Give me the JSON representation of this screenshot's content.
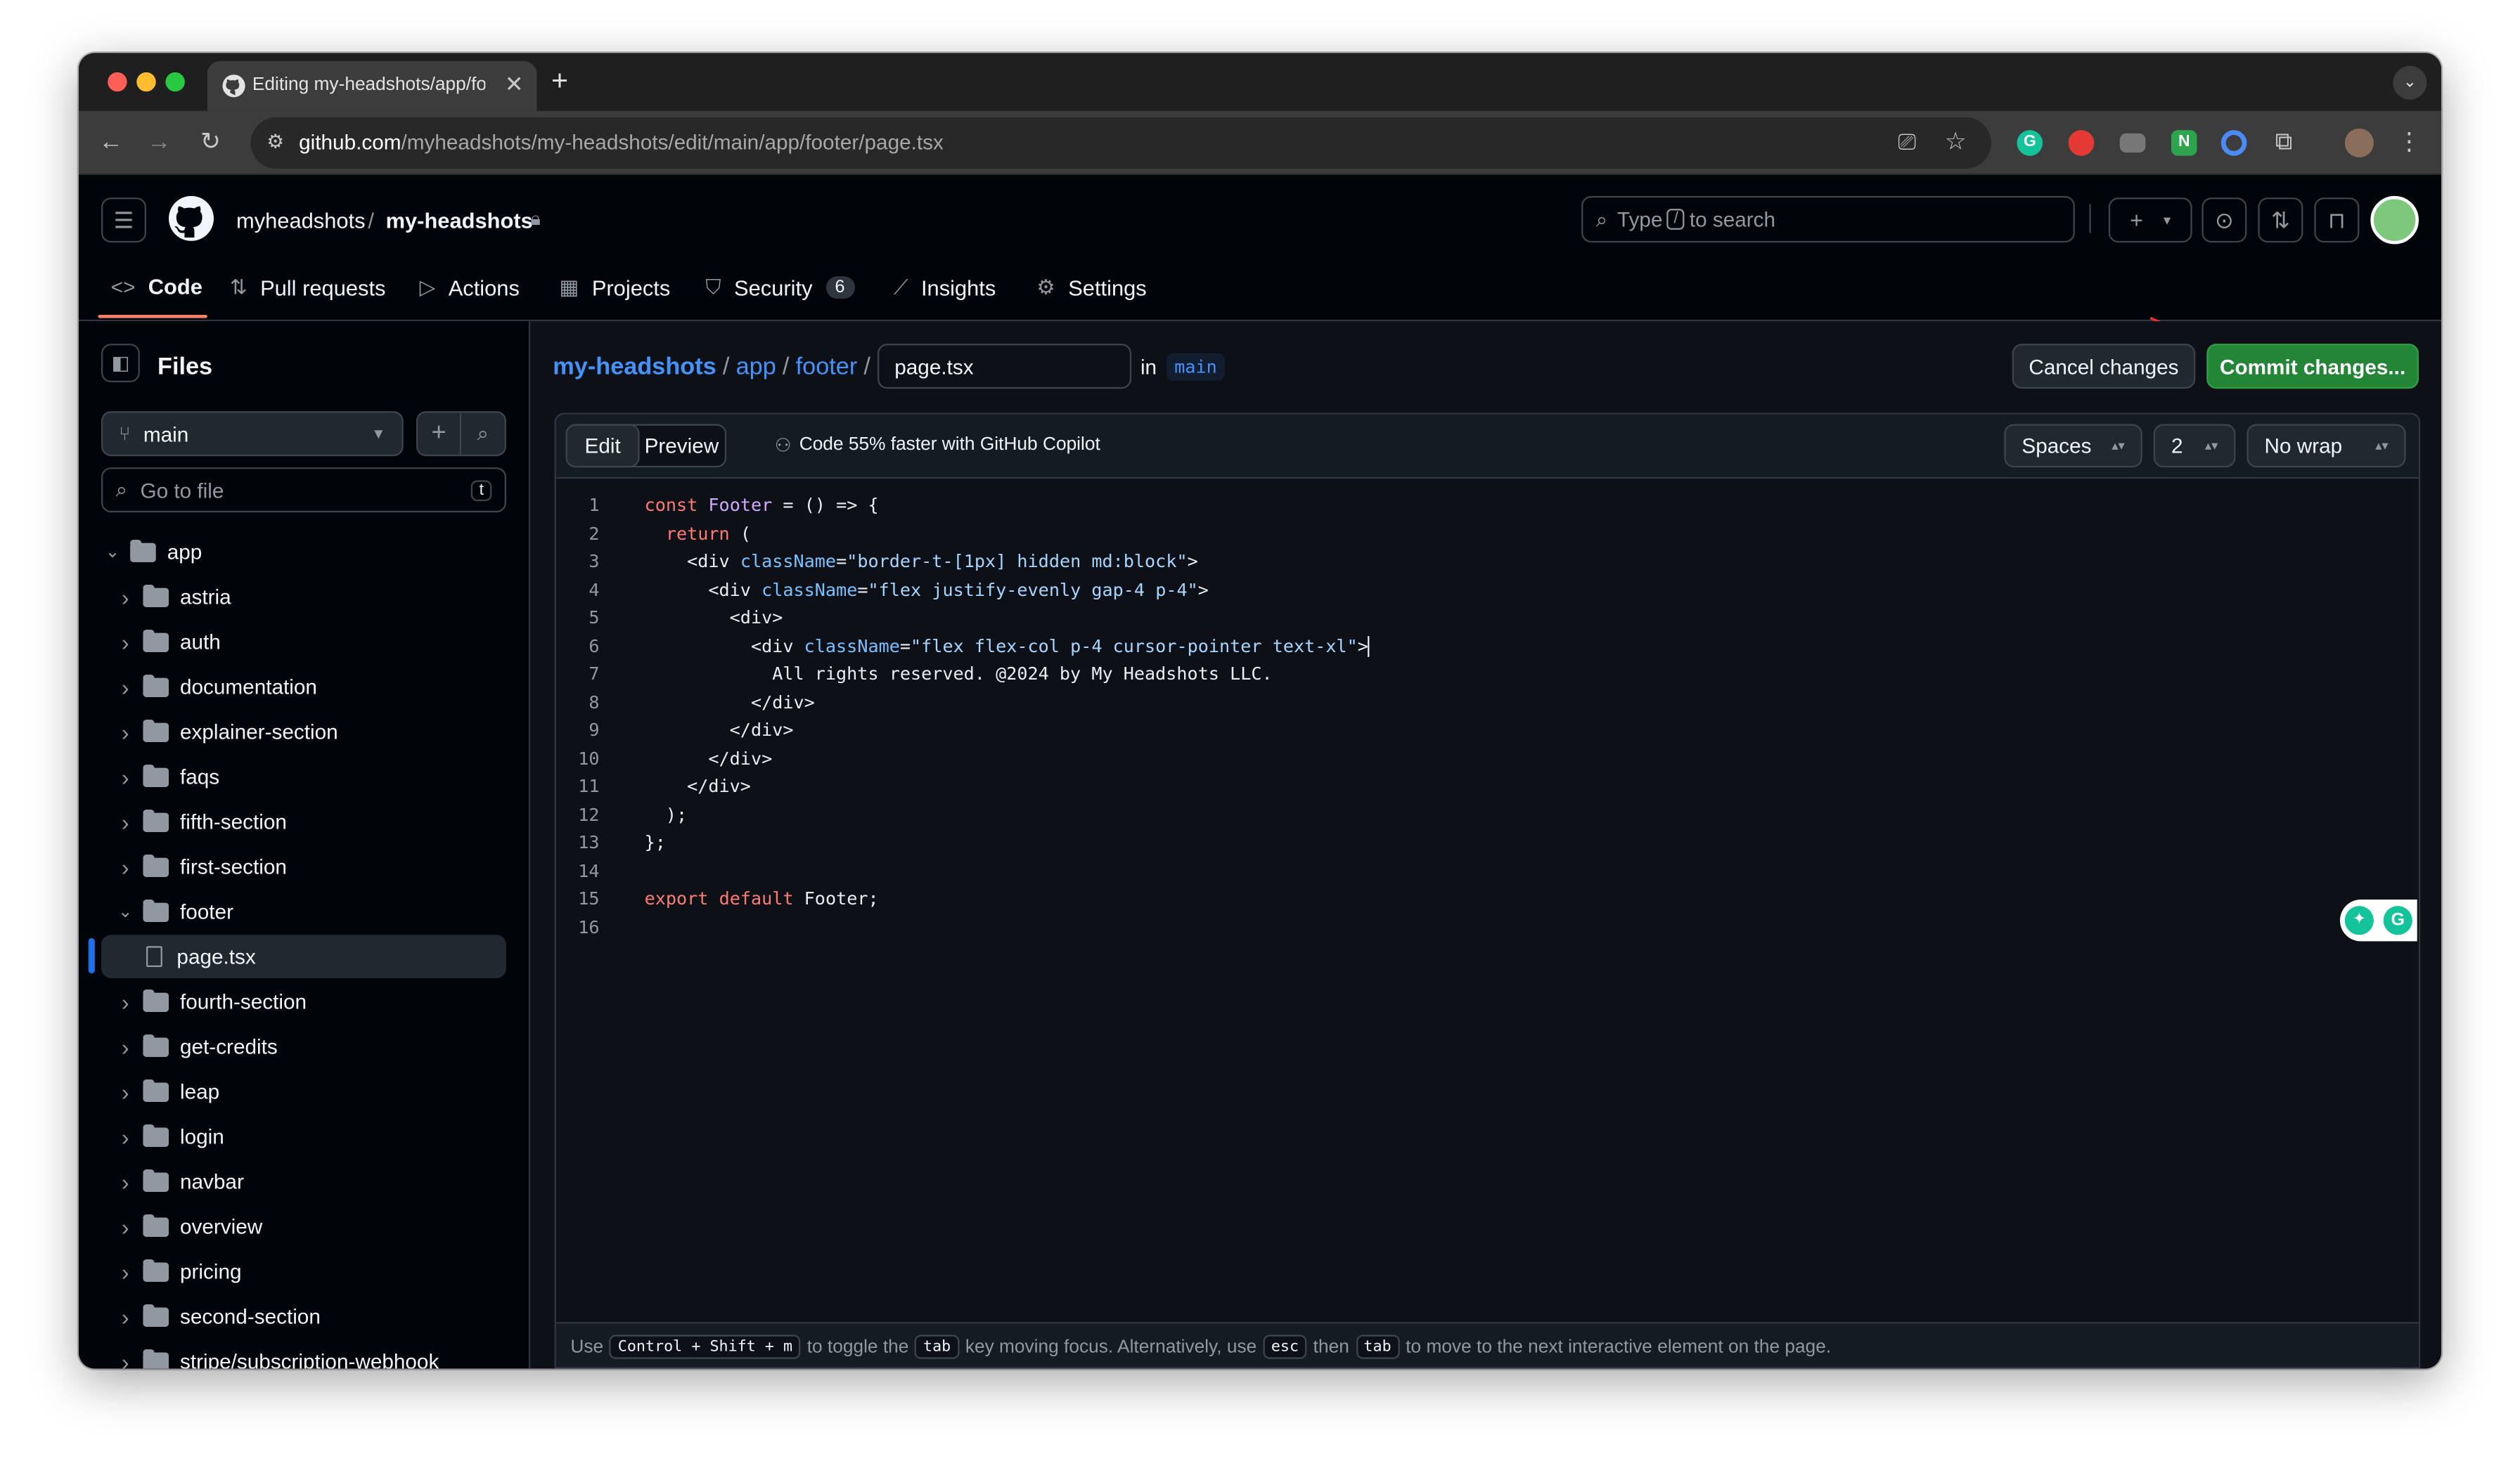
{
  "browser": {
    "tab_title": "Editing my-headshots/app/fo",
    "url_host": "github.com",
    "url_path": "/myheadshots/my-headshots/edit/main/app/footer/page.tsx"
  },
  "header": {
    "owner": "myheadshots",
    "separator": "/",
    "repo": "my-headshots",
    "search_prefix": "Type",
    "search_key": "/",
    "search_suffix": "to search"
  },
  "nav": [
    {
      "label": "Code",
      "icon": "code-icon"
    },
    {
      "label": "Pull requests",
      "icon": "pull-request-icon"
    },
    {
      "label": "Actions",
      "icon": "play-icon"
    },
    {
      "label": "Projects",
      "icon": "table-icon"
    },
    {
      "label": "Security",
      "icon": "shield-icon",
      "count": "6"
    },
    {
      "label": "Insights",
      "icon": "graph-icon"
    },
    {
      "label": "Settings",
      "icon": "gear-icon"
    }
  ],
  "sidebar": {
    "title": "Files",
    "branch": "main",
    "goto_placeholder": "Go to file",
    "goto_key": "t",
    "tree": [
      {
        "name": "app",
        "type": "folder",
        "open": true,
        "depth": 0
      },
      {
        "name": "astria",
        "type": "folder",
        "depth": 1
      },
      {
        "name": "auth",
        "type": "folder",
        "depth": 1
      },
      {
        "name": "documentation",
        "type": "folder",
        "depth": 1
      },
      {
        "name": "explainer-section",
        "type": "folder",
        "depth": 1
      },
      {
        "name": "faqs",
        "type": "folder",
        "depth": 1
      },
      {
        "name": "fifth-section",
        "type": "folder",
        "depth": 1
      },
      {
        "name": "first-section",
        "type": "folder",
        "depth": 1
      },
      {
        "name": "footer",
        "type": "folder",
        "open": true,
        "depth": 1
      },
      {
        "name": "page.tsx",
        "type": "file",
        "selected": true,
        "depth": 2
      },
      {
        "name": "fourth-section",
        "type": "folder",
        "depth": 1
      },
      {
        "name": "get-credits",
        "type": "folder",
        "depth": 1
      },
      {
        "name": "leap",
        "type": "folder",
        "depth": 1
      },
      {
        "name": "login",
        "type": "folder",
        "depth": 1
      },
      {
        "name": "navbar",
        "type": "folder",
        "depth": 1
      },
      {
        "name": "overview",
        "type": "folder",
        "depth": 1
      },
      {
        "name": "pricing",
        "type": "folder",
        "depth": 1
      },
      {
        "name": "second-section",
        "type": "folder",
        "depth": 1
      },
      {
        "name": "stripe/subscription-webhook",
        "type": "folder",
        "depth": 1
      }
    ]
  },
  "breadcrumb": {
    "repo": "my-headshots",
    "parts": [
      "app",
      "footer"
    ],
    "filename": "page.tsx",
    "in_label": "in",
    "branch": "main"
  },
  "actions": {
    "cancel": "Cancel changes",
    "commit": "Commit changes..."
  },
  "editor": {
    "tab_edit": "Edit",
    "tab_preview": "Preview",
    "copilot": "Code 55% faster with GitHub Copilot",
    "indent_mode": "Spaces",
    "indent_size": "2",
    "wrap_mode": "No wrap",
    "lines": [
      "const Footer = () => {",
      "  return (",
      "    <div className=\"border-t-[1px] hidden md:block\">",
      "      <div className=\"flex justify-evenly gap-4 p-4\">",
      "        <div>",
      "          <div className=\"flex flex-col p-4 cursor-pointer text-xl\">",
      "            All rights reserved. @2024 by My Headshots LLC.",
      "          </div>",
      "        </div>",
      "      </div>",
      "    </div>",
      "  );",
      "};",
      "",
      "export default Footer;",
      ""
    ]
  },
  "footer_hint": {
    "t1": "Use",
    "k1": "Control + Shift + m",
    "t2": "to toggle the",
    "k2": "tab",
    "t3": "key moving focus. Alternatively, use",
    "k3": "esc",
    "t4": "then",
    "k4": "tab",
    "t5": "to move to the next interactive element on the page."
  },
  "colors": {
    "commit_green": "#238636",
    "link_blue": "#4493f8",
    "annotation_arrow": "#e5322d"
  }
}
